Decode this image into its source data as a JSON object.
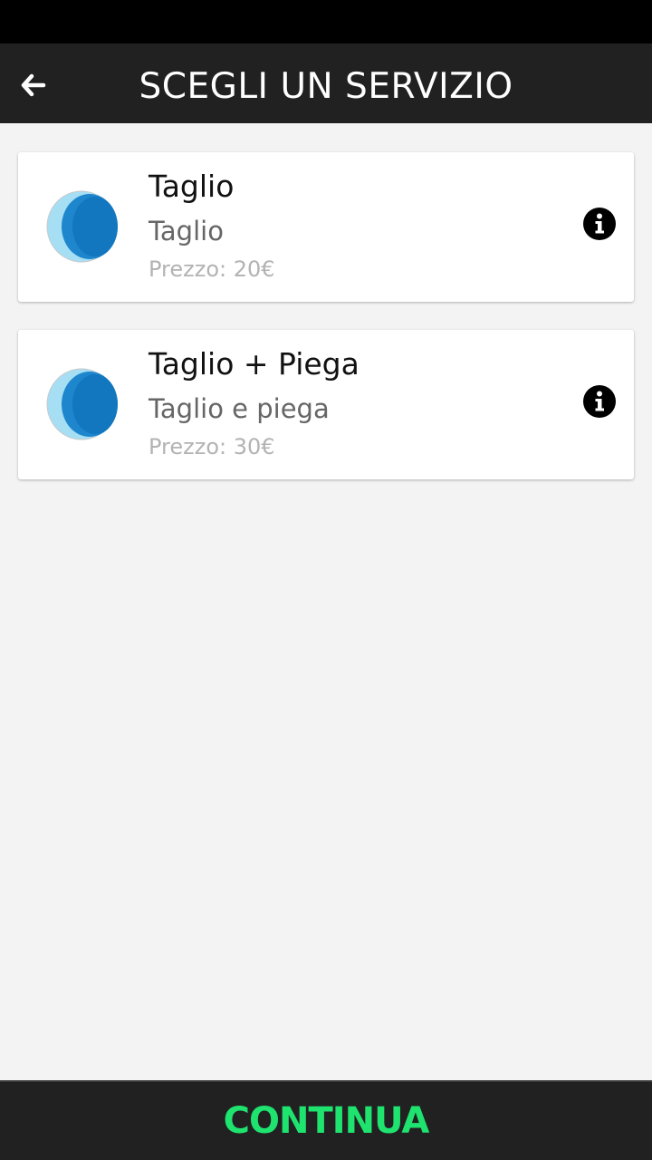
{
  "header": {
    "title": "SCEGLI UN SERVIZIO",
    "back_icon": "arrow-left-icon"
  },
  "services": [
    {
      "title": "Taglio",
      "description": "Taglio",
      "price": "Prezzo: 20€",
      "icon": "service-logo-icon",
      "info_icon": "info-icon"
    },
    {
      "title": "Taglio + Piega",
      "description": "Taglio e piega",
      "price": "Prezzo: 30€",
      "icon": "service-logo-icon",
      "info_icon": "info-icon"
    }
  ],
  "footer": {
    "continue_label": "CONTINUA"
  },
  "colors": {
    "app_bar": "#212121",
    "status_bar": "#000000",
    "background": "#f3f3f3",
    "accent_green": "#1fe36f",
    "logo_light": "#9ad8f0",
    "logo_dark": "#0a74c0"
  }
}
